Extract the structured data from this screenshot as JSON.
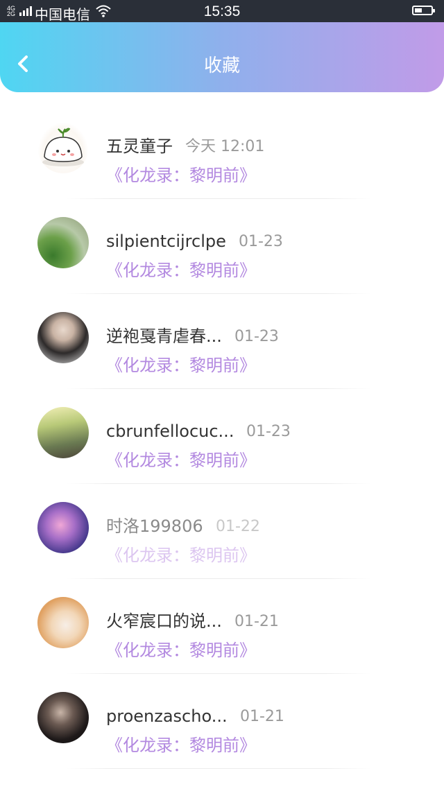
{
  "status_bar": {
    "network_top": "4G",
    "network_bottom": "2G",
    "carrier": "中国电信",
    "time": "15:35",
    "battery_level": 0.45
  },
  "header": {
    "title": "收藏",
    "back_icon": "chevron-left-icon"
  },
  "accent_colors": {
    "header_gradient": [
      "#4fd6f2",
      "#c19be8"
    ],
    "book_title": "#b389e0"
  },
  "items": [
    {
      "name": "五灵童子",
      "time": "今天 12:01",
      "book": "《化龙录：黎明前》",
      "avatar": "cartoon-bun-avatar"
    },
    {
      "name": "silpientcijrclpe",
      "time": "01-23",
      "book": "《化龙录：黎明前》",
      "avatar": "girl-on-grass-avatar"
    },
    {
      "name": "逆袍戛青虐春...",
      "time": "01-23",
      "book": "《化龙录：黎明前》",
      "avatar": "girl-portrait-avatar"
    },
    {
      "name": "cbrunfellocuc...",
      "time": "01-23",
      "book": "《化龙录：黎明前》",
      "avatar": "sunlit-field-avatar"
    },
    {
      "name": "时洛199806",
      "time": "01-22",
      "book": "《化龙录：黎明前》",
      "avatar": "galaxy-avatar"
    },
    {
      "name": "火窄宸口的说...",
      "time": "01-21",
      "book": "《化龙录：黎明前》",
      "avatar": "girl-shoulders-avatar"
    },
    {
      "name": "proenzascho...",
      "time": "01-21",
      "book": "《化龙录：黎明前》",
      "avatar": "dark-hand-avatar"
    }
  ]
}
